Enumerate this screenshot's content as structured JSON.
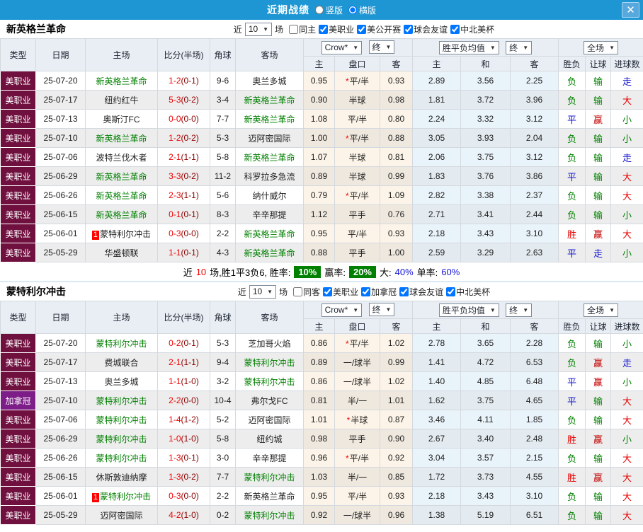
{
  "titlebar": {
    "title": "近期战绩",
    "layout_options": [
      {
        "label": "竖版",
        "checked": false
      },
      {
        "label": "横版",
        "checked": true
      }
    ],
    "close_label": "✕"
  },
  "star_label": "*",
  "badge_label": "1",
  "colors": {
    "topbar": "#1e96d3",
    "team_green": "#008000",
    "score_red": "#f00000",
    "half_red": "#8b0000",
    "badge_green_bg": "#008000",
    "type_bg": {
      "美职业": "#70103f",
      "加拿冠": "#7d1d87"
    },
    "result": {
      "胜": "#e60000",
      "平": "#1515d0",
      "负": "#008000",
      "赢": "#c40000",
      "输": "#008000",
      "走": "#1515d0",
      "大": "#e60000",
      "小": "#008000"
    }
  },
  "table_header": {
    "type": "类型",
    "date": "日期",
    "home": "主场",
    "score": "比分(半场)",
    "corner": "角球",
    "away": "客场",
    "crow_dd": "Crow*",
    "final_dd": "终",
    "avg_dd": "胜平负均值",
    "final_dd2": "终",
    "full_dd": "全场",
    "sub_home": "主",
    "sub_handicap": "盘口",
    "sub_away": "客",
    "sub_avg_home": "主",
    "sub_avg_draw": "和",
    "sub_avg_away": "客",
    "wdl": "胜负",
    "let_ball": "让球",
    "goals": "进球数"
  },
  "sections": [
    {
      "team": "新英格兰革命",
      "near_label": "近",
      "count": "10",
      "games_label": "场",
      "filters": [
        {
          "label": "同主",
          "checked": false
        },
        {
          "label": "美职业",
          "checked": true
        },
        {
          "label": "美公开赛",
          "checked": true
        },
        {
          "label": "球会友谊",
          "checked": true
        },
        {
          "label": "中北美杯",
          "checked": true
        }
      ],
      "summary": {
        "near": "近",
        "count": "10",
        "stats": "场,胜1平3负6, 胜率:",
        "win_pct": "10%",
        "profit_label": "赢率:",
        "profit_pct": "20%",
        "big_label": "大:",
        "big_pct": "40%",
        "single_label": "单率:",
        "single_pct": "60%"
      },
      "rows": [
        {
          "type": "美职业",
          "date": "25-07-20",
          "home": "新英格兰革命",
          "home_green": true,
          "home_badge": false,
          "score": "1-2",
          "half": "(0-1)",
          "corner": "9-6",
          "away": "奥兰多城",
          "away_green": false,
          "crow_home": "0.95",
          "handicap": "平/半",
          "star": true,
          "crow_away": "0.93",
          "avg_home": "2.89",
          "avg_draw": "3.56",
          "avg_away": "2.25",
          "wdl": "负",
          "let": "输",
          "goal": "走"
        },
        {
          "type": "美职业",
          "date": "25-07-17",
          "home": "纽约红牛",
          "home_green": false,
          "home_badge": false,
          "score": "5-3",
          "half": "(0-2)",
          "corner": "3-4",
          "away": "新英格兰革命",
          "away_green": true,
          "crow_home": "0.90",
          "handicap": "半球",
          "star": false,
          "crow_away": "0.98",
          "avg_home": "1.81",
          "avg_draw": "3.72",
          "avg_away": "3.96",
          "wdl": "负",
          "let": "输",
          "goal": "大"
        },
        {
          "type": "美职业",
          "date": "25-07-13",
          "home": "奥斯汀FC",
          "home_green": false,
          "home_badge": false,
          "score": "0-0",
          "half": "(0-0)",
          "corner": "7-7",
          "away": "新英格兰革命",
          "away_green": true,
          "crow_home": "1.08",
          "handicap": "平/半",
          "star": false,
          "crow_away": "0.80",
          "avg_home": "2.24",
          "avg_draw": "3.32",
          "avg_away": "3.12",
          "wdl": "平",
          "let": "赢",
          "goal": "小"
        },
        {
          "type": "美职业",
          "date": "25-07-10",
          "home": "新英格兰革命",
          "home_green": true,
          "home_badge": false,
          "score": "1-2",
          "half": "(0-2)",
          "corner": "5-3",
          "away": "迈阿密国际",
          "away_green": false,
          "crow_home": "1.00",
          "handicap": "平/半",
          "star": true,
          "crow_away": "0.88",
          "avg_home": "3.05",
          "avg_draw": "3.93",
          "avg_away": "2.04",
          "wdl": "负",
          "let": "输",
          "goal": "小"
        },
        {
          "type": "美职业",
          "date": "25-07-06",
          "home": "波特兰伐木者",
          "home_green": false,
          "home_badge": false,
          "score": "2-1",
          "half": "(1-1)",
          "corner": "5-8",
          "away": "新英格兰革命",
          "away_green": true,
          "crow_home": "1.07",
          "handicap": "半球",
          "star": false,
          "crow_away": "0.81",
          "avg_home": "2.06",
          "avg_draw": "3.75",
          "avg_away": "3.12",
          "wdl": "负",
          "let": "输",
          "goal": "走"
        },
        {
          "type": "美职业",
          "date": "25-06-29",
          "home": "新英格兰革命",
          "home_green": true,
          "home_badge": false,
          "score": "3-3",
          "half": "(0-2)",
          "corner": "11-2",
          "away": "科罗拉多急流",
          "away_green": false,
          "crow_home": "0.89",
          "handicap": "半球",
          "star": false,
          "crow_away": "0.99",
          "avg_home": "1.83",
          "avg_draw": "3.76",
          "avg_away": "3.86",
          "wdl": "平",
          "let": "输",
          "goal": "大"
        },
        {
          "type": "美职业",
          "date": "25-06-26",
          "home": "新英格兰革命",
          "home_green": true,
          "home_badge": false,
          "score": "2-3",
          "half": "(1-1)",
          "corner": "5-6",
          "away": "纳什威尔",
          "away_green": false,
          "crow_home": "0.79",
          "handicap": "平/半",
          "star": true,
          "crow_away": "1.09",
          "avg_home": "2.82",
          "avg_draw": "3.38",
          "avg_away": "2.37",
          "wdl": "负",
          "let": "输",
          "goal": "大"
        },
        {
          "type": "美职业",
          "date": "25-06-15",
          "home": "新英格兰革命",
          "home_green": true,
          "home_badge": false,
          "score": "0-1",
          "half": "(0-1)",
          "corner": "8-3",
          "away": "辛辛那提",
          "away_green": false,
          "crow_home": "1.12",
          "handicap": "平手",
          "star": false,
          "crow_away": "0.76",
          "avg_home": "2.71",
          "avg_draw": "3.41",
          "avg_away": "2.44",
          "wdl": "负",
          "let": "输",
          "goal": "小"
        },
        {
          "type": "美职业",
          "date": "25-06-01",
          "home": "蒙特利尔冲击",
          "home_green": false,
          "home_badge": true,
          "score": "0-3",
          "half": "(0-0)",
          "corner": "2-2",
          "away": "新英格兰革命",
          "away_green": true,
          "crow_home": "0.95",
          "handicap": "平/半",
          "star": false,
          "crow_away": "0.93",
          "avg_home": "2.18",
          "avg_draw": "3.43",
          "avg_away": "3.10",
          "wdl": "胜",
          "let": "赢",
          "goal": "大"
        },
        {
          "type": "美职业",
          "date": "25-05-29",
          "home": "华盛顿联",
          "home_green": false,
          "home_badge": false,
          "score": "1-1",
          "half": "(0-1)",
          "corner": "4-3",
          "away": "新英格兰革命",
          "away_green": true,
          "crow_home": "0.88",
          "handicap": "平手",
          "star": false,
          "crow_away": "1.00",
          "avg_home": "2.59",
          "avg_draw": "3.29",
          "avg_away": "2.63",
          "wdl": "平",
          "let": "走",
          "goal": "小"
        }
      ]
    },
    {
      "team": "蒙特利尔冲击",
      "near_label": "近",
      "count": "10",
      "games_label": "场",
      "filters": [
        {
          "label": "同客",
          "checked": false
        },
        {
          "label": "美职业",
          "checked": true
        },
        {
          "label": "加拿冠",
          "checked": true
        },
        {
          "label": "球会友谊",
          "checked": true
        },
        {
          "label": "中北美杯",
          "checked": true
        }
      ],
      "rows": [
        {
          "type": "美职业",
          "date": "25-07-20",
          "home": "蒙特利尔冲击",
          "home_green": true,
          "home_badge": false,
          "score": "0-2",
          "half": "(0-1)",
          "corner": "5-3",
          "away": "芝加哥火焰",
          "away_green": false,
          "crow_home": "0.86",
          "handicap": "平/半",
          "star": true,
          "crow_away": "1.02",
          "avg_home": "2.78",
          "avg_draw": "3.65",
          "avg_away": "2.28",
          "wdl": "负",
          "let": "输",
          "goal": "小"
        },
        {
          "type": "美职业",
          "date": "25-07-17",
          "home": "费城联合",
          "home_green": false,
          "home_badge": false,
          "score": "2-1",
          "half": "(1-1)",
          "corner": "9-4",
          "away": "蒙特利尔冲击",
          "away_green": true,
          "crow_home": "0.89",
          "handicap": "一/球半",
          "star": false,
          "crow_away": "0.99",
          "avg_home": "1.41",
          "avg_draw": "4.72",
          "avg_away": "6.53",
          "wdl": "负",
          "let": "赢",
          "goal": "走"
        },
        {
          "type": "美职业",
          "date": "25-07-13",
          "home": "奥兰多城",
          "home_green": false,
          "home_badge": false,
          "score": "1-1",
          "half": "(1-0)",
          "corner": "3-2",
          "away": "蒙特利尔冲击",
          "away_green": true,
          "crow_home": "0.86",
          "handicap": "一/球半",
          "star": false,
          "crow_away": "1.02",
          "avg_home": "1.40",
          "avg_draw": "4.85",
          "avg_away": "6.48",
          "wdl": "平",
          "let": "赢",
          "goal": "小"
        },
        {
          "type": "加拿冠",
          "date": "25-07-10",
          "home": "蒙特利尔冲击",
          "home_green": true,
          "home_badge": false,
          "score": "2-2",
          "half": "(0-0)",
          "corner": "10-4",
          "away": "弗尔戈FC",
          "away_green": false,
          "crow_home": "0.81",
          "handicap": "半/一",
          "star": false,
          "crow_away": "1.01",
          "avg_home": "1.62",
          "avg_draw": "3.75",
          "avg_away": "4.65",
          "wdl": "平",
          "let": "输",
          "goal": "大"
        },
        {
          "type": "美职业",
          "date": "25-07-06",
          "home": "蒙特利尔冲击",
          "home_green": true,
          "home_badge": false,
          "score": "1-4",
          "half": "(1-2)",
          "corner": "5-2",
          "away": "迈阿密国际",
          "away_green": false,
          "crow_home": "1.01",
          "handicap": "半球",
          "star": true,
          "crow_away": "0.87",
          "avg_home": "3.46",
          "avg_draw": "4.11",
          "avg_away": "1.85",
          "wdl": "负",
          "let": "输",
          "goal": "大"
        },
        {
          "type": "美职业",
          "date": "25-06-29",
          "home": "蒙特利尔冲击",
          "home_green": true,
          "home_badge": false,
          "score": "1-0",
          "half": "(1-0)",
          "corner": "5-8",
          "away": "纽约城",
          "away_green": false,
          "crow_home": "0.98",
          "handicap": "平手",
          "star": false,
          "crow_away": "0.90",
          "avg_home": "2.67",
          "avg_draw": "3.40",
          "avg_away": "2.48",
          "wdl": "胜",
          "let": "赢",
          "goal": "小"
        },
        {
          "type": "美职业",
          "date": "25-06-26",
          "home": "蒙特利尔冲击",
          "home_green": true,
          "home_badge": false,
          "score": "1-3",
          "half": "(0-1)",
          "corner": "3-0",
          "away": "辛辛那提",
          "away_green": false,
          "crow_home": "0.96",
          "handicap": "平/半",
          "star": true,
          "crow_away": "0.92",
          "avg_home": "3.04",
          "avg_draw": "3.57",
          "avg_away": "2.15",
          "wdl": "负",
          "let": "输",
          "goal": "大"
        },
        {
          "type": "美职业",
          "date": "25-06-15",
          "home": "休斯敦迪纳摩",
          "home_green": false,
          "home_badge": false,
          "score": "1-3",
          "half": "(0-2)",
          "corner": "7-7",
          "away": "蒙特利尔冲击",
          "away_green": true,
          "crow_home": "1.03",
          "handicap": "半/一",
          "star": false,
          "crow_away": "0.85",
          "avg_home": "1.72",
          "avg_draw": "3.73",
          "avg_away": "4.55",
          "wdl": "胜",
          "let": "赢",
          "goal": "大"
        },
        {
          "type": "美职业",
          "date": "25-06-01",
          "home": "蒙特利尔冲击",
          "home_green": true,
          "home_badge": true,
          "score": "0-3",
          "half": "(0-0)",
          "corner": "2-2",
          "away": "新英格兰革命",
          "away_green": false,
          "crow_home": "0.95",
          "handicap": "平/半",
          "star": false,
          "crow_away": "0.93",
          "avg_home": "2.18",
          "avg_draw": "3.43",
          "avg_away": "3.10",
          "wdl": "负",
          "let": "输",
          "goal": "大"
        },
        {
          "type": "美职业",
          "date": "25-05-29",
          "home": "迈阿密国际",
          "home_green": false,
          "home_badge": false,
          "score": "4-2",
          "half": "(1-0)",
          "corner": "0-2",
          "away": "蒙特利尔冲击",
          "away_green": true,
          "crow_home": "0.92",
          "handicap": "一/球半",
          "star": false,
          "crow_away": "0.96",
          "avg_home": "1.38",
          "avg_draw": "5.19",
          "avg_away": "6.51",
          "wdl": "负",
          "let": "输",
          "goal": "大"
        }
      ]
    }
  ]
}
